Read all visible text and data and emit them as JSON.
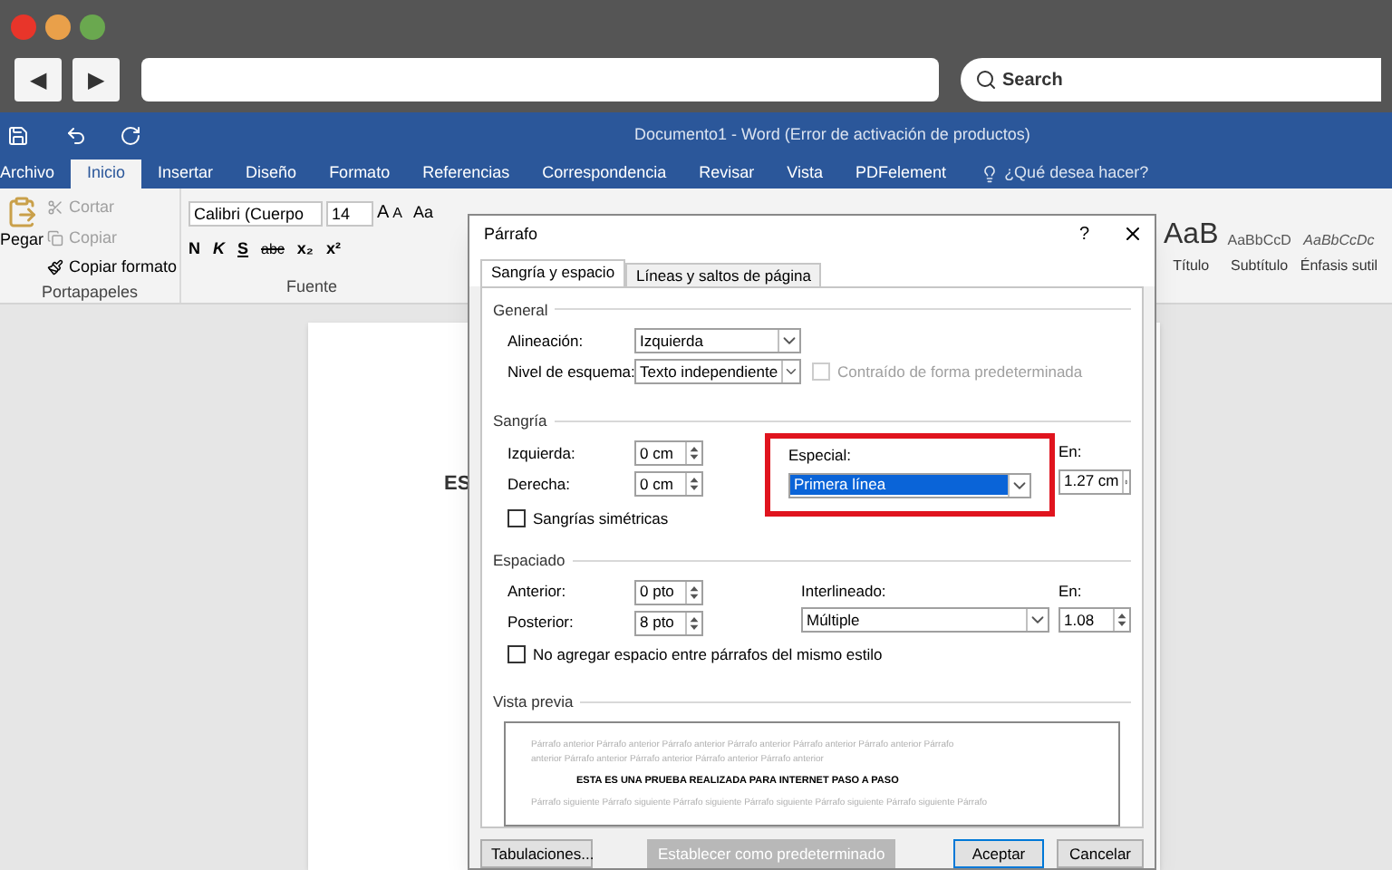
{
  "frame": {
    "nav_buttons": [
      "◀",
      "▶"
    ],
    "search": {
      "placeholder": "Search"
    }
  },
  "titlebar": {
    "title": "Documento1 - Word (Error de activación de productos)"
  },
  "tabs": [
    {
      "label": "Archivo",
      "selected": false
    },
    {
      "label": "Inicio",
      "selected": true
    },
    {
      "label": "Insertar",
      "selected": false
    },
    {
      "label": "Diseño",
      "selected": false
    },
    {
      "label": "Formato",
      "selected": false
    },
    {
      "label": "Referencias",
      "selected": false
    },
    {
      "label": "Correspondencia",
      "selected": false
    },
    {
      "label": "Revisar",
      "selected": false
    },
    {
      "label": "Vista",
      "selected": false
    },
    {
      "label": "PDFelement",
      "selected": false
    }
  ],
  "tell_me": "¿Qué desea hacer?",
  "ribbon": {
    "clipboard": {
      "paste": "Pegar",
      "items": [
        {
          "label": "Cortar",
          "disabled": true
        },
        {
          "label": "Copiar",
          "disabled": true
        },
        {
          "label": "Copiar formato",
          "disabled": false
        }
      ],
      "group": "Portapapeles"
    },
    "font": {
      "name": "Calibri (Cuerpo",
      "size": "14",
      "grow": "A",
      "shrink": "A",
      "case": "Aa",
      "format_buttons": [
        "N",
        "K",
        "S",
        "abc",
        "x₂",
        "x²"
      ],
      "group": "Fuente"
    },
    "styles": [
      {
        "sample": "AaB",
        "name": "Título",
        "kind": "title"
      },
      {
        "sample": "AaBbCcD",
        "name": "Subtítulo",
        "kind": "subtitle"
      },
      {
        "sample": "AaBbCcDc",
        "name": "Énfasis sutil",
        "kind": "emphasis"
      }
    ]
  },
  "document": {
    "text": "ES"
  },
  "dialog": {
    "title": "Párrafo",
    "help": "?",
    "tabs": [
      {
        "label": "Sangría y espacio",
        "selected": true
      },
      {
        "label": "Líneas y saltos de página",
        "selected": false
      }
    ],
    "general": {
      "label": "General",
      "alignment": {
        "label": "Alineación:",
        "value": "Izquierda",
        "kind": "dropdown"
      },
      "outline": {
        "label": "Nivel de esquema:",
        "value": "Texto independiente",
        "kind": "dropdown"
      },
      "collapsed": {
        "label": "Contraído de forma predeterminada",
        "checked": false,
        "disabled": true
      }
    },
    "indent": {
      "label": "Sangría",
      "left": {
        "label": "Izquierda:",
        "value": "0 cm",
        "kind": "spin"
      },
      "right": {
        "label": "Derecha:",
        "value": "0 cm",
        "kind": "spin"
      },
      "special": {
        "label": "Especial:",
        "value": "Primera línea",
        "kind": "dropdown",
        "highlighted": true,
        "marked": true
      },
      "by": {
        "label": "En:",
        "value": "1.27 cm",
        "kind": "spin"
      },
      "mirror": {
        "label": "Sangrías simétricas",
        "checked": false,
        "disabled": false
      }
    },
    "spacing": {
      "label": "Espaciado",
      "before": {
        "label": "Anterior:",
        "value": "0 pto",
        "kind": "spin"
      },
      "after": {
        "label": "Posterior:",
        "value": "8 pto",
        "kind": "spin"
      },
      "line": {
        "label": "Interlineado:",
        "value": "Múltiple",
        "kind": "dropdown"
      },
      "at": {
        "label": "En:",
        "value": "1.08",
        "kind": "spin"
      },
      "no_space": {
        "label": "No agregar espacio entre párrafos del mismo estilo",
        "checked": false,
        "disabled": false
      }
    },
    "preview": {
      "label": "Vista previa",
      "previous": [
        "Párrafo anterior Párrafo anterior Párrafo anterior Párrafo anterior Párrafo anterior Párrafo anterior Párrafo",
        "anterior Párrafo anterior Párrafo anterior Párrafo anterior Párrafo anterior"
      ],
      "sample": "ESTA ES UNA PRUEBA REALIZADA PARA INTERNET PASO A PASO",
      "following": [
        "Párrafo siguiente Párrafo siguiente Párrafo siguiente Párrafo siguiente Párrafo siguiente Párrafo siguiente Párrafo"
      ]
    },
    "buttons": [
      {
        "label": "Tabulaciones...",
        "disabled": false,
        "default": false
      },
      {
        "label": "Establecer como predeterminado",
        "disabled": true,
        "default": false
      },
      {
        "label": "Aceptar",
        "disabled": false,
        "default": true
      },
      {
        "label": "Cancelar",
        "disabled": false,
        "default": false
      }
    ]
  }
}
